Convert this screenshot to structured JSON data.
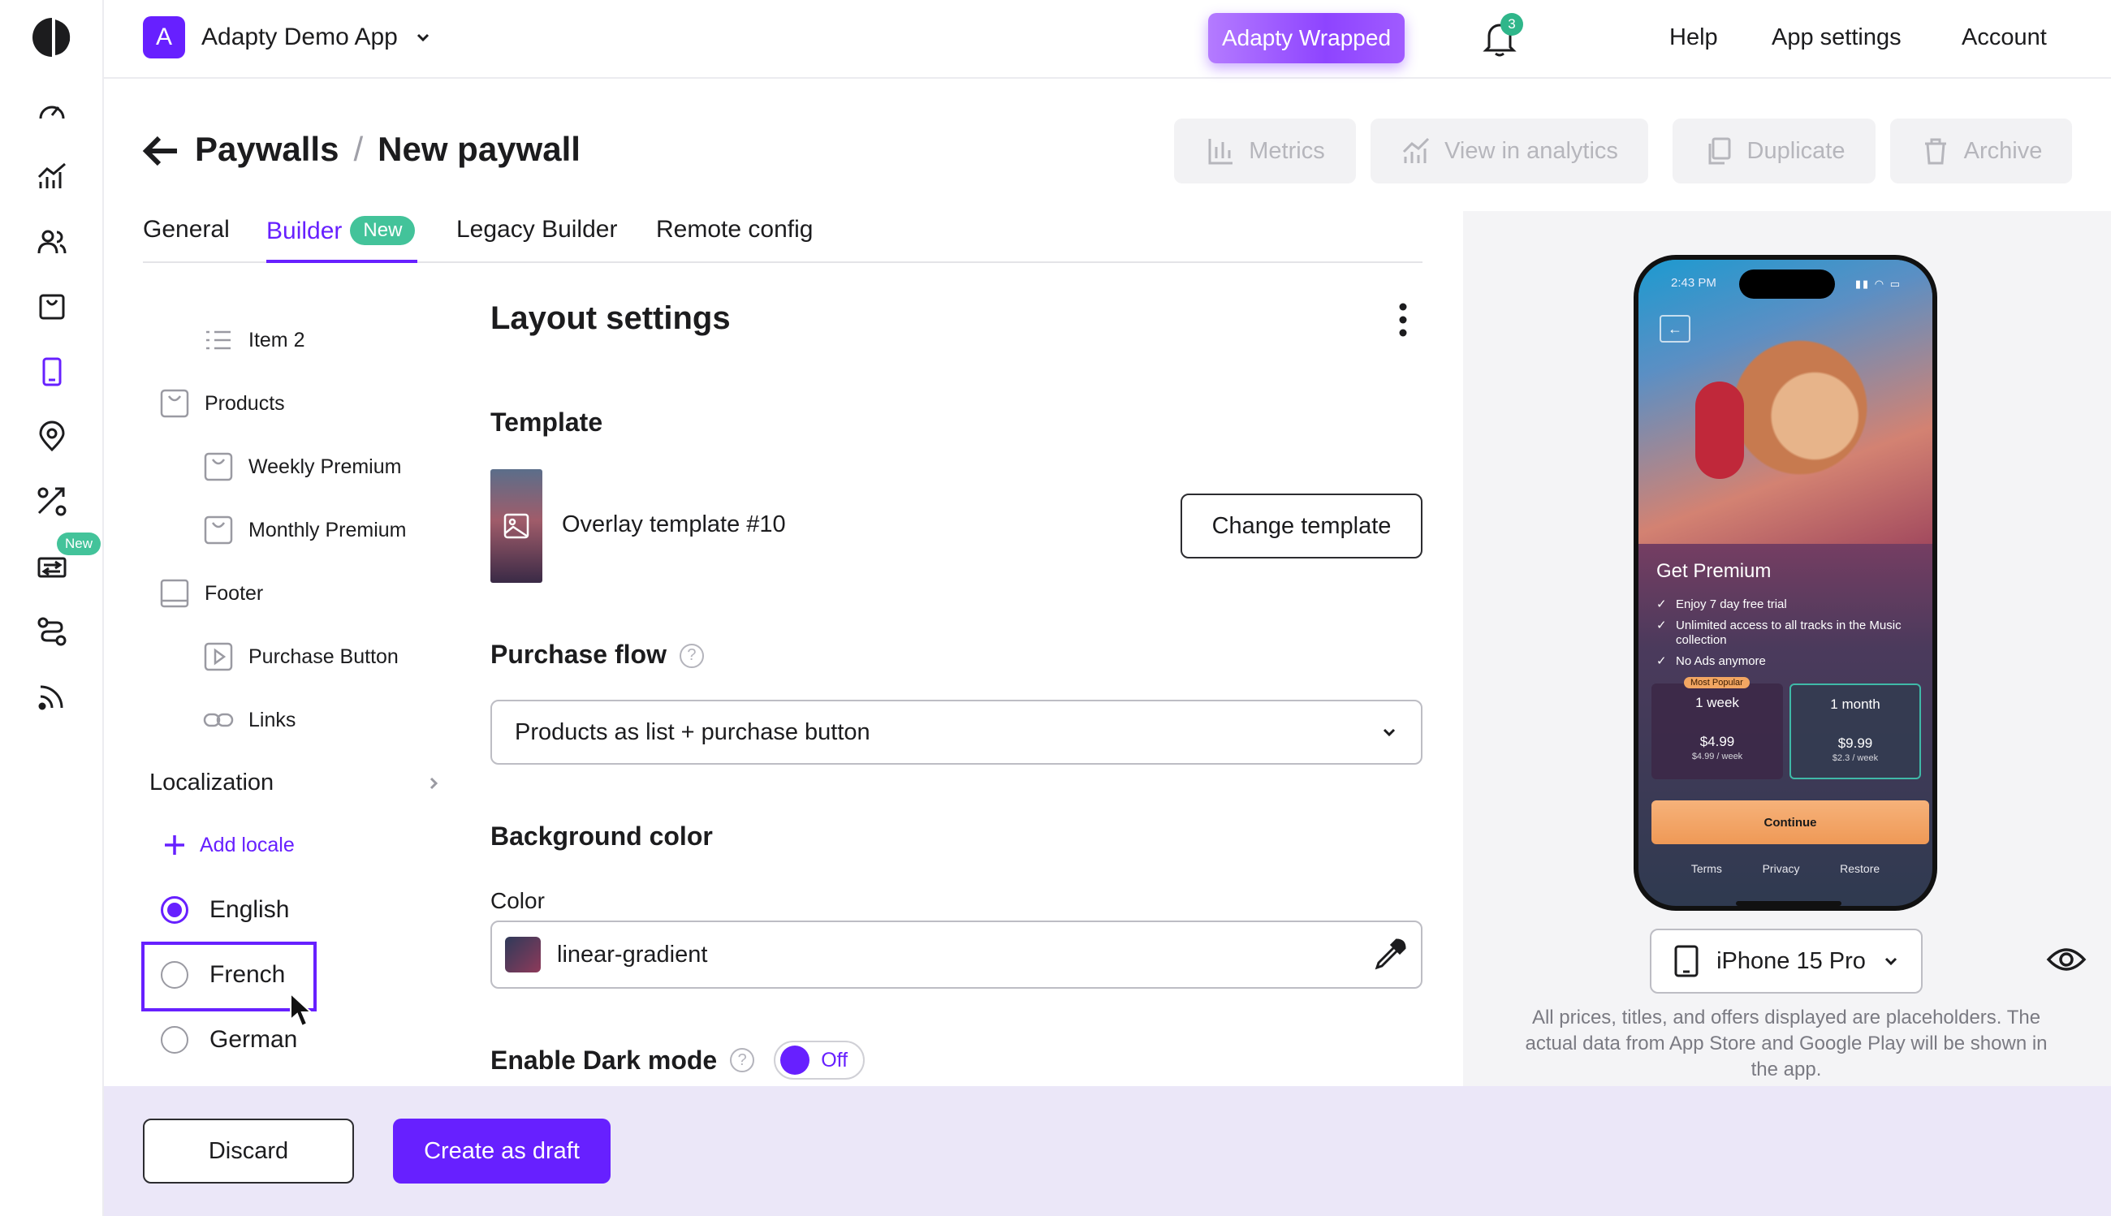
{
  "topbar": {
    "app_initial": "A",
    "app_name": "Adapty Demo App",
    "wrapped_label": "Adapty Wrapped",
    "notification_count": "3",
    "help": "Help",
    "app_settings": "App settings",
    "account": "Account"
  },
  "sidebar": {
    "new_badge": "New",
    "icons": [
      "dashboard-icon",
      "analytics-icon",
      "profiles-icon",
      "products-icon",
      "paywalls-icon",
      "placements-icon",
      "ab-tests-icon",
      "transactions-icon",
      "flows-icon",
      "integrations-icon"
    ]
  },
  "breadcrumb": {
    "parent": "Paywalls",
    "separator": "/",
    "current": "New paywall"
  },
  "actions": {
    "metrics": "Metrics",
    "view_in_analytics": "View in analytics",
    "duplicate": "Duplicate",
    "archive": "Archive"
  },
  "tabs": {
    "general": "General",
    "builder": "Builder",
    "builder_badge": "New",
    "legacy_builder": "Legacy Builder",
    "remote_config": "Remote config"
  },
  "tree": {
    "item2": "Item 2",
    "products": "Products",
    "weekly": "Weekly Premium",
    "monthly": "Monthly Premium",
    "footer": "Footer",
    "purchase_button": "Purchase Button",
    "links": "Links"
  },
  "localization": {
    "title": "Localization",
    "add_locale": "Add locale",
    "locales": [
      {
        "name": "English",
        "selected": true
      },
      {
        "name": "French",
        "selected": false
      },
      {
        "name": "German",
        "selected": false
      }
    ]
  },
  "settings": {
    "title": "Layout settings",
    "template_heading": "Template",
    "template_name": "Overlay template #10",
    "change_template": "Change template",
    "purchase_flow_heading": "Purchase flow",
    "purchase_flow_value": "Products as list + purchase button",
    "background_heading": "Background color",
    "color_label": "Color",
    "color_value": "linear-gradient",
    "dark_mode_heading": "Enable Dark mode",
    "dark_mode_state": "Off"
  },
  "preview": {
    "status_time": "2:43 PM",
    "back_glyph": "←",
    "title": "Get Premium",
    "features": [
      "Enjoy 7 day free trial",
      "Unlimited access to all tracks in the Music collection",
      "No Ads anymore"
    ],
    "plans": [
      {
        "badge": "Most Popular",
        "name": "1 week",
        "price": "$4.99",
        "sub": "$4.99 / week"
      },
      {
        "badge": "",
        "name": "1 month",
        "price": "$9.99",
        "sub": "$2.3 / week"
      }
    ],
    "continue": "Continue",
    "links": [
      "Terms",
      "Privacy",
      "Restore"
    ],
    "device": "iPhone 15 Pro",
    "note": "All prices, titles, and offers displayed are placeholders. The actual data from App Store and Google Play will be shown in the app."
  },
  "footer_bar": {
    "discard": "Discard",
    "create_draft": "Create as draft"
  },
  "colors": {
    "accent": "#6720ff",
    "new_badge": "#43c39a",
    "bottom_bar": "#ebe7f8"
  }
}
